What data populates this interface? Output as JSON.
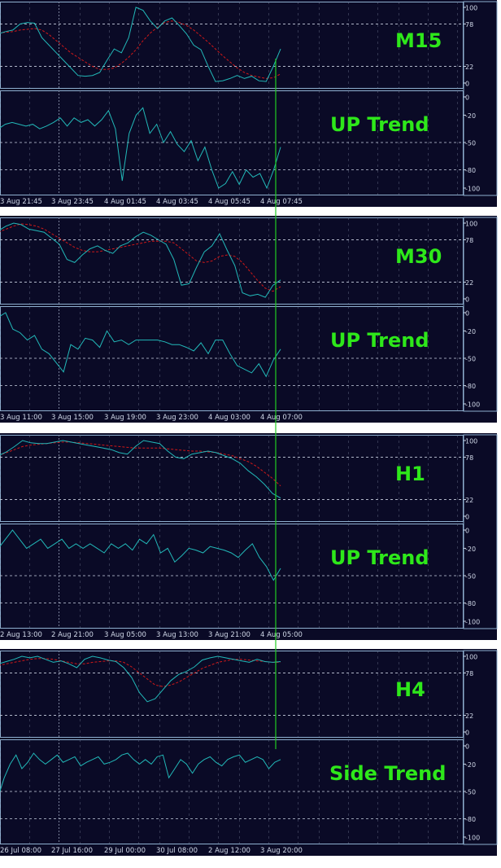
{
  "colors": {
    "background": "#0a0a26",
    "page": "#ffffff",
    "grid": "#8890a8",
    "frame": "#8fb0d0",
    "main_line": "#22b8b8",
    "signal_line": "#d01818",
    "label": "#2ee81a",
    "axis_text": "#d0d8e8",
    "marker_line": "#22cc22"
  },
  "panels": [
    {
      "timeframe": "M15",
      "trend": "UP Trend",
      "x_ticks": [
        "3 Aug 21:45",
        "3 Aug 23:45",
        "4 Aug 01:45",
        "4 Aug 03:45",
        "4 Aug 05:45",
        "4 Aug 07:45"
      ],
      "upper_ticks": [
        "100",
        "78",
        "22",
        "0"
      ],
      "lower_ticks": [
        "0",
        "-20",
        "-50",
        "-80",
        "-100"
      ]
    },
    {
      "timeframe": "M30",
      "trend": "UP Trend",
      "x_ticks": [
        "3 Aug 11:00",
        "3 Aug 15:00",
        "3 Aug 19:00",
        "3 Aug 23:00",
        "4 Aug 03:00",
        "4 Aug 07:00"
      ],
      "upper_ticks": [
        "100",
        "78",
        "22",
        "0"
      ],
      "lower_ticks": [
        "0",
        "-20",
        "-50",
        "-80",
        "-100"
      ]
    },
    {
      "timeframe": "H1",
      "trend": "UP Trend",
      "x_ticks": [
        "2 Aug 13:00",
        "2 Aug 21:00",
        "3 Aug 05:00",
        "3 Aug 13:00",
        "3 Aug 21:00",
        "4 Aug 05:00"
      ],
      "upper_ticks": [
        "100",
        "78",
        "22",
        "0"
      ],
      "lower_ticks": [
        "0",
        "-20",
        "-50",
        "-80",
        "-100"
      ]
    },
    {
      "timeframe": "H4",
      "trend": "Side Trend",
      "x_ticks": [
        "26 Jul 08:00",
        "27 Jul 16:00",
        "29 Jul 00:00",
        "30 Jul 08:00",
        "2 Aug 12:00",
        "3 Aug 20:00"
      ],
      "upper_ticks": [
        "100",
        "78",
        "22",
        "0"
      ],
      "lower_ticks": [
        "0",
        "-20",
        "-50",
        "-80",
        "-100"
      ]
    }
  ],
  "chart_data": [
    {
      "type": "line",
      "timeframe": "M15",
      "upper": {
        "ylim": [
          0,
          100
        ],
        "levels": [
          78,
          22
        ],
        "series": [
          {
            "values": [
              65,
              68,
              70,
              78,
              80,
              79,
              60,
              50,
              40,
              30,
              20,
              10,
              9,
              10,
              14,
              30,
              45,
              40,
              60,
              100,
              96,
              82,
              72,
              82,
              86,
              76,
              65,
              50,
              44,
              22,
              2,
              3,
              6,
              10,
              6,
              9,
              3,
              2,
              22,
              45
            ]
          },
          {
            "values": [
              66,
              67,
              68,
              70,
              71,
              72,
              70,
              64,
              56,
              48,
              40,
              34,
              28,
              22,
              18,
              18,
              20,
              26,
              34,
              44,
              56,
              66,
              74,
              80,
              82,
              80,
              76,
              70,
              62,
              54,
              45,
              36,
              28,
              20,
              14,
              10,
              8,
              6,
              7,
              12
            ]
          }
        ]
      },
      "lower": {
        "ylim": [
          -100,
          0
        ],
        "series": [
          {
            "values": [
              -35,
              -30,
              -28,
              -30,
              -32,
              -30,
              -35,
              -32,
              -28,
              -23,
              -32,
              -23,
              -28,
              -25,
              -32,
              -25,
              -15,
              -35,
              -92,
              -40,
              -20,
              -12,
              -40,
              -30,
              -50,
              -38,
              -52,
              -60,
              -48,
              -70,
              -55,
              -80,
              -100,
              -95,
              -82,
              -96,
              -80,
              -88,
              -84,
              -100,
              -80,
              -55
            ]
          }
        ]
      }
    },
    {
      "type": "line",
      "timeframe": "M30",
      "upper": {
        "ylim": [
          0,
          100
        ],
        "levels": [
          78,
          22
        ],
        "series": [
          {
            "values": [
              90,
              96,
              100,
              98,
              92,
              90,
              88,
              80,
              72,
              52,
              48,
              58,
              66,
              70,
              64,
              60,
              70,
              74,
              82,
              88,
              84,
              78,
              72,
              52,
              18,
              20,
              42,
              62,
              70,
              86,
              64,
              44,
              8,
              4,
              6,
              2,
              18,
              25
            ]
          },
          {
            "values": [
              88,
              92,
              96,
              99,
              98,
              96,
              92,
              86,
              80,
              74,
              68,
              64,
              62,
              62,
              64,
              66,
              68,
              70,
              72,
              74,
              76,
              76,
              76,
              74,
              66,
              58,
              50,
              48,
              50,
              56,
              58,
              56,
              48,
              36,
              24,
              14,
              10,
              16
            ]
          }
        ]
      },
      "lower": {
        "ylim": [
          -100,
          0
        ],
        "series": [
          {
            "values": [
              -5,
              0,
              -18,
              -22,
              -30,
              -25,
              -40,
              -45,
              -55,
              -65,
              -35,
              -40,
              -28,
              -30,
              -38,
              -20,
              -32,
              -30,
              -35,
              -30,
              -30,
              -30,
              -30,
              -32,
              -35,
              -35,
              -38,
              -42,
              -33,
              -45,
              -30,
              -30,
              -45,
              -58,
              -62,
              -66,
              -56,
              -70,
              -52,
              -40
            ]
          }
        ]
      }
    },
    {
      "type": "line",
      "timeframe": "H1",
      "upper": {
        "ylim": [
          0,
          100
        ],
        "levels": [
          78,
          22
        ],
        "series": [
          {
            "values": [
              80,
              85,
              92,
              100,
              97,
              96,
              96,
              98,
              100,
              98,
              96,
              94,
              92,
              90,
              88,
              84,
              82,
              92,
              100,
              98,
              96,
              86,
              78,
              76,
              82,
              84,
              86,
              84,
              80,
              76,
              70,
              60,
              52,
              42,
              30,
              24
            ]
          },
          {
            "values": [
              80,
              84,
              88,
              92,
              94,
              95,
              96,
              97,
              98,
              98,
              97,
              96,
              95,
              94,
              93,
              92,
              91,
              90,
              90,
              90,
              90,
              89,
              88,
              87,
              86,
              86,
              85,
              84,
              82,
              80,
              76,
              72,
              66,
              58,
              50,
              40
            ]
          }
        ]
      },
      "lower": {
        "ylim": [
          -100,
          0
        ],
        "series": [
          {
            "values": [
              -20,
              -10,
              0,
              -10,
              -20,
              -15,
              -10,
              -20,
              -15,
              -10,
              -20,
              -15,
              -20,
              -15,
              -20,
              -25,
              -15,
              -20,
              -15,
              -22,
              -10,
              -15,
              -5,
              -25,
              -20,
              -35,
              -28,
              -20,
              -22,
              -25,
              -18,
              -20,
              -22,
              -25,
              -30,
              -22,
              -15,
              -30,
              -40,
              -55,
              -42
            ]
          }
        ]
      }
    },
    {
      "type": "line",
      "timeframe": "H4",
      "upper": {
        "ylim": [
          0,
          100
        ],
        "levels": [
          78,
          22
        ],
        "series": [
          {
            "values": [
              90,
              93,
              96,
              100,
              98,
              100,
              96,
              92,
              94,
              90,
              85,
              96,
              100,
              98,
              95,
              93,
              85,
              72,
              52,
              40,
              44,
              56,
              68,
              76,
              80,
              86,
              95,
              98,
              100,
              98,
              96,
              94,
              92,
              96,
              93,
              92,
              93
            ]
          },
          {
            "values": [
              88,
              90,
              92,
              94,
              96,
              97,
              97,
              96,
              94,
              92,
              90,
              90,
              92,
              93,
              94,
              94,
              92,
              86,
              78,
              70,
              62,
              60,
              62,
              66,
              72,
              78,
              84,
              88,
              92,
              94,
              96,
              96,
              95,
              94,
              93,
              92,
              92
            ]
          }
        ]
      },
      "lower": {
        "ylim": [
          -100,
          0
        ],
        "series": [
          {
            "values": [
              -55,
              -35,
              -20,
              -10,
              -25,
              -18,
              -8,
              -15,
              -20,
              -15,
              -10,
              -18,
              -15,
              -12,
              -22,
              -18,
              -15,
              -12,
              -20,
              -18,
              -15,
              -10,
              -8,
              -15,
              -20,
              -15,
              -20,
              -12,
              -10,
              -35,
              -25,
              -15,
              -20,
              -30,
              -20,
              -15,
              -12,
              -18,
              -22,
              -15,
              -12,
              -10,
              -18,
              -15,
              -12,
              -15,
              -25,
              -18,
              -15
            ]
          }
        ]
      }
    }
  ]
}
